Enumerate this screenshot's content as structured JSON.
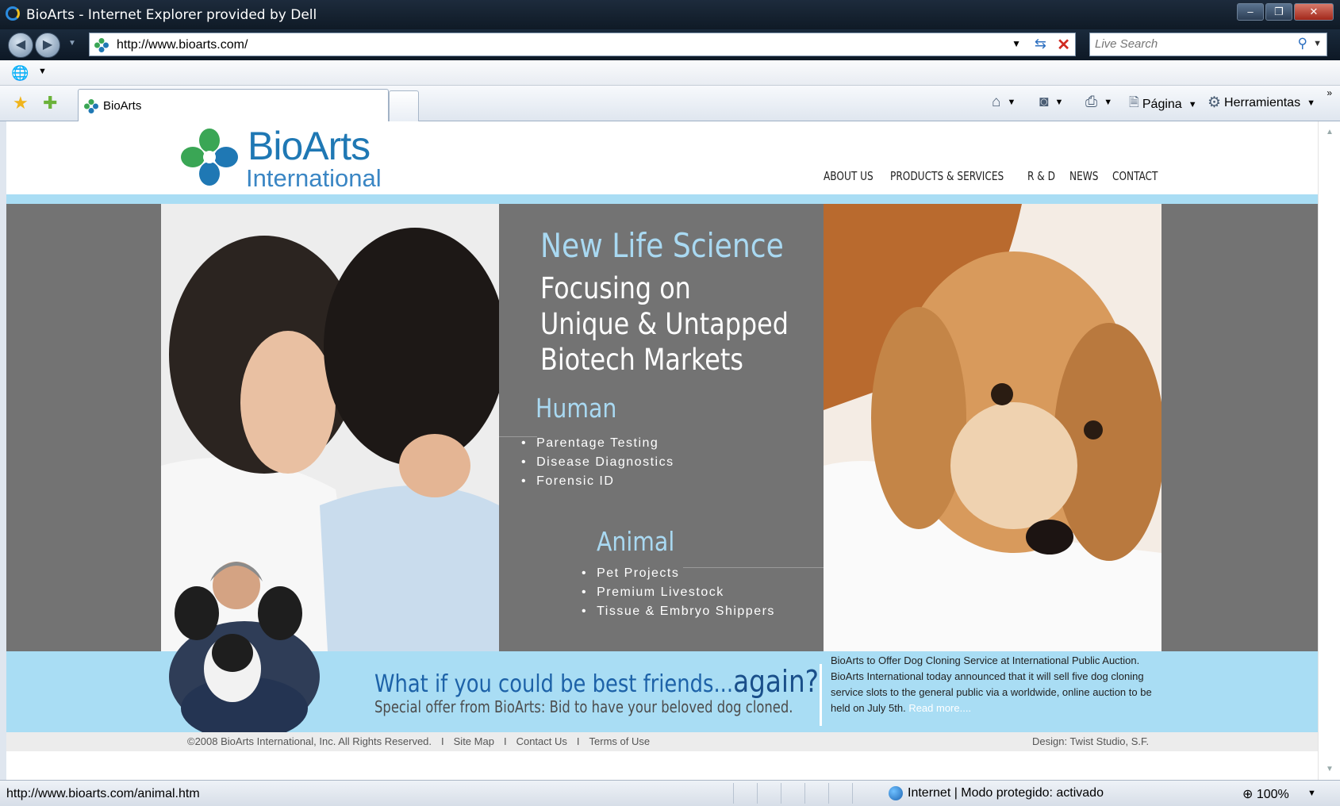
{
  "window": {
    "title": "BioArts - Internet Explorer provided by Dell",
    "minimize": "–",
    "restore": "❐",
    "close": "✕"
  },
  "browser": {
    "back_glyph": "◀",
    "forward_glyph": "▶",
    "history_dd": "▼",
    "address": "http://www.bioarts.com/",
    "address_dd": "▼",
    "refresh_glyph": "⇆",
    "stop_glyph": "✕",
    "search_placeholder": "Live Search",
    "search_glyph": "⚲",
    "search_dd": "▼",
    "menu_dd": "▼",
    "tab_label": "BioArts",
    "more_chevron": "»"
  },
  "commands": {
    "home_glyph": "⌂",
    "feeds_glyph": "◙",
    "print_glyph": "⎙",
    "page_label": "Página",
    "tools_label": "Herramientas",
    "dd": "▼"
  },
  "site": {
    "logo_name": "BioArts",
    "logo_sub": "International",
    "nav": [
      "ABOUT US",
      "PRODUCTS & SERVICES",
      "R & D",
      "NEWS",
      "CONTACT"
    ],
    "hero": {
      "title": "New Life Science",
      "subtitle_lines": [
        "Focusing on",
        "Unique & Untapped",
        "Biotech Markets"
      ],
      "human_heading": "Human",
      "human_items": [
        "Parentage Testing",
        "Disease Diagnostics",
        "Forensic ID"
      ],
      "animal_heading": "Animal",
      "animal_items": [
        "Pet Projects",
        "Premium Livestock",
        "Tissue & Embryo Shippers"
      ]
    },
    "promo": {
      "question_a": "What if you could be best friends...",
      "question_b": "again?",
      "subline": "Special offer from BioArts: Bid to have your beloved dog cloned."
    },
    "news": {
      "headline": "BioArts to Offer Dog Cloning Service at International Public Auction.",
      "body": "BioArts International today announced that it will sell five dog cloning service slots to the general public via a worldwide, online auction to be held on July 5th.",
      "more": "Read more...."
    },
    "footer": {
      "copyright": "©2008 BioArts International, Inc. All Rights Reserved.",
      "sep": "I",
      "links": [
        "Site Map",
        "Contact Us",
        "Terms of Use"
      ],
      "design": "Design: Twist Studio, S.F."
    },
    "colors": {
      "brand_blue": "#1f78b4",
      "logo_green": "#3aa655",
      "hero_grey": "#737373",
      "light_blue": "#a9ddf4",
      "heading_blue": "#a9d9f2"
    }
  },
  "status": {
    "url": "http://www.bioarts.com/animal.htm",
    "zone": "Internet | Modo protegido: activado",
    "zoom": "100%",
    "zoom_dd": "▼"
  },
  "scroll": {
    "up": "▲",
    "down": "▼"
  }
}
